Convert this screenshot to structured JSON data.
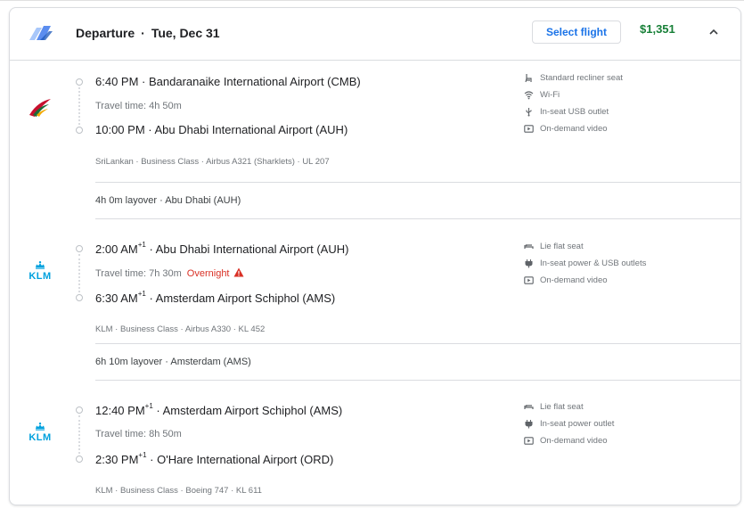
{
  "header": {
    "direction": "Departure",
    "date": "Tue, Dec 31",
    "select_label": "Select flight",
    "price": "$1,351"
  },
  "segments": [
    {
      "airline": "SriLankan",
      "departure": {
        "time": "6:40 PM",
        "day_offset": "",
        "airport": "Bandaranaike International Airport (CMB)"
      },
      "travel_time": "Travel time: 4h 50m",
      "overnight": "",
      "arrival": {
        "time": "10:00 PM",
        "day_offset": "",
        "airport": "Abu Dhabi International Airport (AUH)"
      },
      "details": "SriLankan · Business Class · Airbus A321 (Sharklets) · UL 207",
      "amenities": [
        {
          "icon": "seat-icon",
          "label": "Standard recliner seat"
        },
        {
          "icon": "wifi-icon",
          "label": "Wi-Fi"
        },
        {
          "icon": "usb-icon",
          "label": "In-seat USB outlet"
        },
        {
          "icon": "video-icon",
          "label": "On-demand video"
        }
      ]
    },
    {
      "airline": "KLM",
      "departure": {
        "time": "2:00 AM",
        "day_offset": "+1",
        "airport": "Abu Dhabi International Airport (AUH)"
      },
      "travel_time": "Travel time: 7h 30m",
      "overnight": "Overnight",
      "arrival": {
        "time": "6:30 AM",
        "day_offset": "+1",
        "airport": "Amsterdam Airport Schiphol (AMS)"
      },
      "details": "KLM · Business Class · Airbus A330 · KL 452",
      "amenities": [
        {
          "icon": "flat-seat-icon",
          "label": "Lie flat seat"
        },
        {
          "icon": "power-icon",
          "label": "In-seat power & USB outlets"
        },
        {
          "icon": "video-icon",
          "label": "On-demand video"
        }
      ]
    },
    {
      "airline": "KLM",
      "departure": {
        "time": "12:40 PM",
        "day_offset": "+1",
        "airport": "Amsterdam Airport Schiphol (AMS)"
      },
      "travel_time": "Travel time: 8h 50m",
      "overnight": "",
      "arrival": {
        "time": "2:30 PM",
        "day_offset": "+1",
        "airport": "O'Hare International Airport (ORD)"
      },
      "details": "KLM · Business Class · Boeing 747 · KL 611",
      "amenities": [
        {
          "icon": "flat-seat-icon",
          "label": "Lie flat seat"
        },
        {
          "icon": "power-icon",
          "label": "In-seat power outlet"
        },
        {
          "icon": "video-icon",
          "label": "On-demand video"
        }
      ]
    }
  ],
  "layovers": [
    "4h 0m layover · Abu Dhabi (AUH)",
    "6h 10m layover · Amsterdam (AMS)"
  ],
  "colors": {
    "accent_blue": "#1a73e8",
    "price_green": "#188038",
    "overnight_red": "#d93025",
    "klm_blue": "#00a1de"
  }
}
